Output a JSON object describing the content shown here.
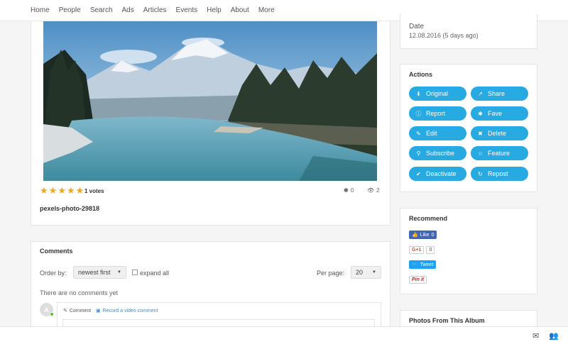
{
  "nav": {
    "items": [
      "Home",
      "People",
      "Search",
      "Ads",
      "Articles",
      "Events",
      "Help",
      "About",
      "More"
    ]
  },
  "photo": {
    "rating_stars": 5,
    "votes": "1 votes",
    "faves_count": "0",
    "views_count": "2",
    "title": "pexels-photo-29818"
  },
  "comments": {
    "title": "Comments",
    "order_label": "Order by:",
    "order_value": "newest first",
    "expand_label": "expand all",
    "per_page_label": "Per page:",
    "per_page_value": "20",
    "empty_text": "There are no comments yet",
    "avatar_letter": "A",
    "tab_comment": "Comment",
    "tab_video": "Record a video comment"
  },
  "sidebar": {
    "date_label": "Date",
    "date_value": "12.08.2016 (5 days ago)",
    "actions_title": "Actions",
    "actions": [
      {
        "label": "Original",
        "icon": "download-icon"
      },
      {
        "label": "Share",
        "icon": "share-icon"
      },
      {
        "label": "Report",
        "icon": "info-icon"
      },
      {
        "label": "Fave",
        "icon": "asterisk-icon"
      },
      {
        "label": "Edit",
        "icon": "edit-icon"
      },
      {
        "label": "Delete",
        "icon": "times-icon"
      },
      {
        "label": "Subscribe",
        "icon": "paperclip-icon"
      },
      {
        "label": "Feature",
        "icon": "star-outline-icon"
      },
      {
        "label": "Deactivate",
        "icon": "check-icon"
      },
      {
        "label": "Repost",
        "icon": "refresh-icon"
      }
    ],
    "recommend_title": "Recommend",
    "recommend": {
      "facebook_label": "Like",
      "facebook_count": "0",
      "gplus_label": "G+1",
      "gplus_count": "0",
      "twitter_label": "Tweet",
      "pinterest_label": "Pin it"
    },
    "album_title": "Photos From This Album"
  },
  "colors": {
    "accent": "#27a9e1",
    "star": "#f0a71b",
    "facebook": "#4267b2",
    "twitter": "#1da1f2",
    "gplus": "#dd4b39",
    "pinterest": "#cb2027"
  }
}
